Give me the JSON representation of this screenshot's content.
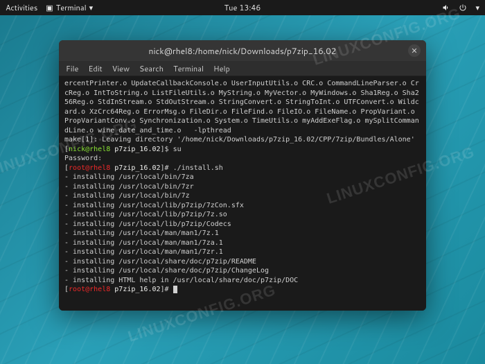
{
  "top_bar": {
    "activities": "Activities",
    "app_indicator": "Terminal",
    "clock": "Tue 13:46"
  },
  "watermark_text": "LINUXCONFIG.ORG",
  "window": {
    "title": "nick@rhel8:/home/nick/Downloads/p7zip_16.02",
    "menu": {
      "file": "File",
      "edit": "Edit",
      "view": "View",
      "search": "Search",
      "terminal": "Terminal",
      "help": "Help"
    }
  },
  "terminal": {
    "compile_output": "ercentPrinter.o UpdateCallbackConsole.o UserInputUtils.o CRC.o CommandLineParser.o CrcReg.o IntToString.o ListFileUtils.o MyString.o MyVector.o MyWindows.o Sha1Reg.o Sha256Reg.o StdInStream.o StdOutStream.o StringConvert.o StringToInt.o UTFConvert.o Wildcard.o XzCrc64Reg.o ErrorMsg.o FileDir.o FileFind.o FileIO.o FileName.o PropVariant.o PropVariantConv.o Synchronization.o System.o TimeUtils.o myAddExeFlag.o mySplitCommandLine.o wine_date_and_time.o   -lpthread",
    "make_leave": "make[1]: Leaving directory '/home/nick/Downloads/p7zip_16.02/CPP/7zip/Bundles/Alone'",
    "user_prompt_user": "nick@rhel8",
    "user_prompt_path": "p7zip_16.02",
    "su_cmd": "su",
    "password_label": "Password:",
    "root_prompt_user": "root@rhel8",
    "root_prompt_path": "p7zip_16.02",
    "install_cmd": "./install.sh",
    "install_lines": [
      "- installing /usr/local/bin/7za",
      "- installing /usr/local/bin/7zr",
      "- installing /usr/local/bin/7z",
      "- installing /usr/local/lib/p7zip/7zCon.sfx",
      "- installing /usr/local/lib/p7zip/7z.so",
      "- installing /usr/local/lib/p7zip/Codecs",
      "- installing /usr/local/man/man1/7z.1",
      "- installing /usr/local/man/man1/7za.1",
      "- installing /usr/local/man/man1/7zr.1",
      "- installing /usr/local/share/doc/p7zip/README",
      "- installing /usr/local/share/doc/p7zip/ChangeLog",
      "- installing HTML help in /usr/local/share/doc/p7zip/DOC"
    ]
  }
}
